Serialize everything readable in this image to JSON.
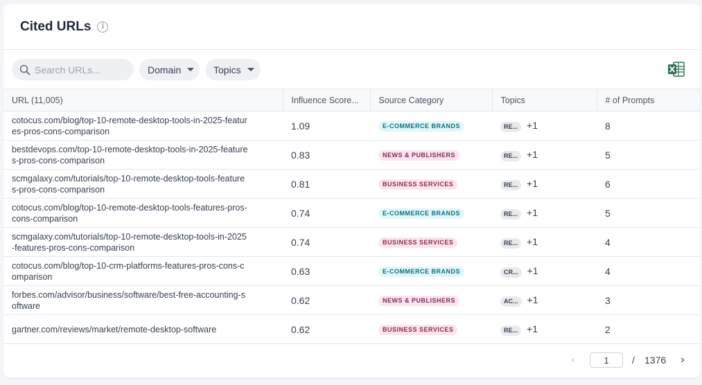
{
  "header": {
    "title": "Cited URLs",
    "info_icon": "info-circle-icon"
  },
  "toolbar": {
    "search": {
      "placeholder": "Search URLs...",
      "value": "",
      "icon": "search-icon"
    },
    "filters": [
      {
        "label": "Domain",
        "icon": "chevron-down-icon"
      },
      {
        "label": "Topics",
        "icon": "chevron-down-icon"
      }
    ],
    "export": {
      "icon": "excel-export-icon"
    }
  },
  "table": {
    "columns": [
      "URL (11,005)",
      "Influence Score...",
      "Source Category",
      "Topics",
      "# of Prompts"
    ],
    "rows": [
      {
        "url": "cotocus.com/blog/top-10-remote-desktop-tools-in-2025-features-pros-cons-comparison",
        "score": "1.09",
        "category": "E-COMMERCE BRANDS",
        "category_type": "ecom",
        "topic": "RE...",
        "topic_more": "+1",
        "prompts": "8"
      },
      {
        "url": "bestdevops.com/top-10-remote-desktop-tools-in-2025-features-pros-cons-comparison",
        "score": "0.83",
        "category": "NEWS & PUBLISHERS",
        "category_type": "news",
        "topic": "RE...",
        "topic_more": "+1",
        "prompts": "5"
      },
      {
        "url": "scmgalaxy.com/tutorials/top-10-remote-desktop-tools-features-pros-cons-comparison",
        "score": "0.81",
        "category": "BUSINESS SERVICES",
        "category_type": "biz",
        "topic": "RE...",
        "topic_more": "+1",
        "prompts": "6"
      },
      {
        "url": "cotocus.com/blog/top-10-remote-desktop-tools-features-pros-cons-comparison",
        "score": "0.74",
        "category": "E-COMMERCE BRANDS",
        "category_type": "ecom",
        "topic": "RE...",
        "topic_more": "+1",
        "prompts": "5"
      },
      {
        "url": "scmgalaxy.com/tutorials/top-10-remote-desktop-tools-in-2025-features-pros-cons-comparison",
        "score": "0.74",
        "category": "BUSINESS SERVICES",
        "category_type": "biz",
        "topic": "RE...",
        "topic_more": "+1",
        "prompts": "4"
      },
      {
        "url": "cotocus.com/blog/top-10-crm-platforms-features-pros-cons-comparison",
        "score": "0.63",
        "category": "E-COMMERCE BRANDS",
        "category_type": "ecom",
        "topic": "CR...",
        "topic_more": "+1",
        "prompts": "4"
      },
      {
        "url": "forbes.com/advisor/business/software/best-free-accounting-software",
        "score": "0.62",
        "category": "NEWS & PUBLISHERS",
        "category_type": "news",
        "topic": "AC...",
        "topic_more": "+1",
        "prompts": "3"
      },
      {
        "url": "gartner.com/reviews/market/remote-desktop-software",
        "score": "0.62",
        "category": "BUSINESS SERVICES",
        "category_type": "biz",
        "topic": "RE...",
        "topic_more": "+1",
        "prompts": "2"
      }
    ]
  },
  "pagination": {
    "current_page": "1",
    "separator": "/",
    "total_pages": "1376",
    "prev_icon": "chevron-left-icon",
    "next_icon": "chevron-right-icon"
  },
  "colors": {
    "ecom_badge_bg": "#e0f7fa",
    "news_badge_bg": "#fbe4f0",
    "biz_badge_bg": "#fde4ec",
    "excel_green": "#2f6f4e"
  }
}
